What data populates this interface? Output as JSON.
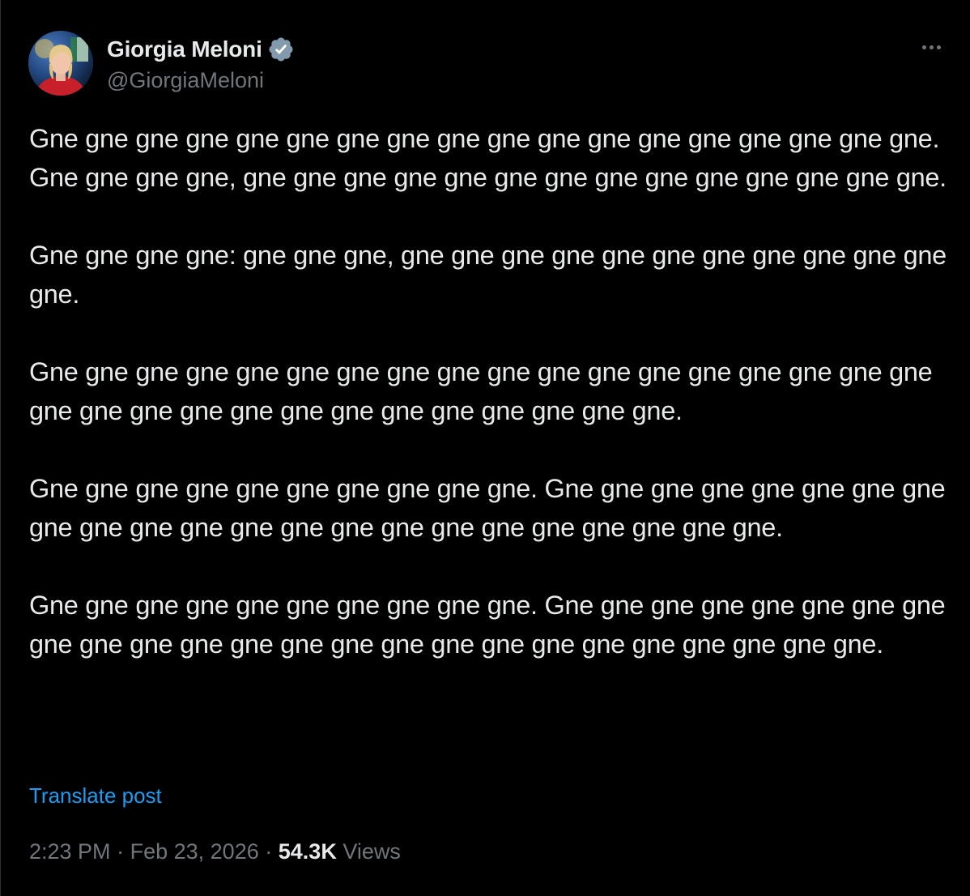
{
  "author": {
    "display_name": "Giorgia Meloni",
    "handle": "@GiorgiaMeloni",
    "verified": true,
    "verified_color": "#829aab"
  },
  "post": {
    "paragraphs": [
      "Gne gne gne gne gne gne gne gne gne gne gne gne gne gne gne gne gne gne.\nGne gne gne gne, gne gne gne gne gne gne gne gne gne gne gne gne gne gne.",
      "Gne gne gne gne: gne gne gne, gne gne gne gne gne gne gne gne gne gne gne gne.",
      "Gne gne gne gne gne gne gne gne gne gne gne gne gne gne gne gne gne gne gne gne gne gne gne gne gne gne gne gne gne gne gne.",
      "Gne gne gne gne gne gne gne gne gne gne. Gne gne gne gne gne gne gne gne gne gne gne gne gne gne gne gne gne gne gne gne gne gne gne.",
      "Gne gne gne gne gne gne gne gne gne gne. Gne gne gne gne gne gne gne gne gne gne gne gne gne gne gne gne gne gne gne gne gne gne gne gne gne."
    ],
    "translate_label": "Translate post",
    "time": "2:23 PM",
    "separator": "·",
    "date": "Feb 23, 2026",
    "views_count": "54.3K",
    "views_label": "Views"
  },
  "icons": {
    "more": "more-horizontal-icon",
    "verified": "verified-badge-icon"
  },
  "colors": {
    "background": "#000000",
    "text": "#e7e9ea",
    "secondary": "#71767b",
    "link": "#1d9bf0"
  }
}
